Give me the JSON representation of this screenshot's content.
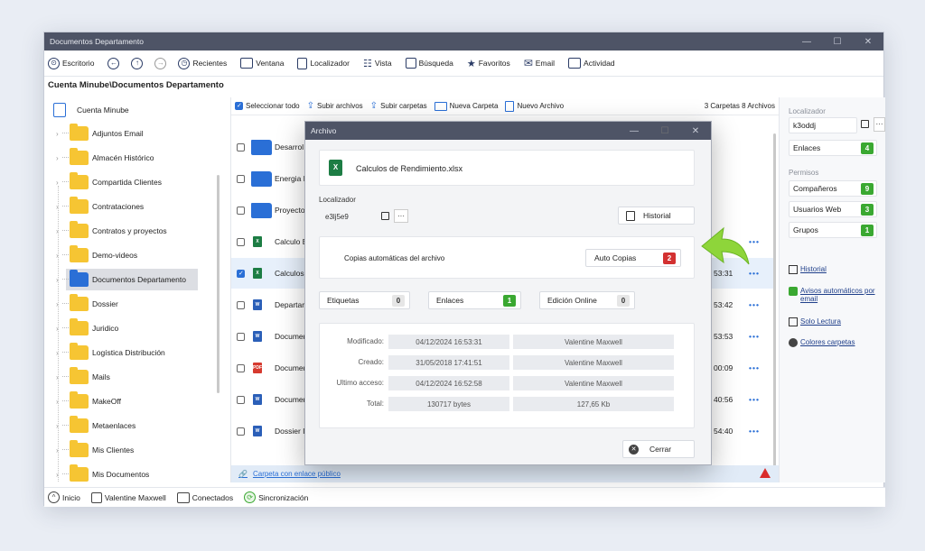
{
  "window": {
    "title": "Documentos Departamento"
  },
  "toolbar": {
    "items": [
      "Escritorio",
      "Recientes",
      "Ventana",
      "Localizador",
      "Vista",
      "Búsqueda",
      "Favoritos",
      "Email",
      "Actividad"
    ]
  },
  "path": "Cuenta Minube\\Documentos Departamento",
  "tree": {
    "root": "Cuenta Minube",
    "items": [
      "Adjuntos Email",
      "Almacén Histórico",
      "Compartida Clientes",
      "Contrataciones",
      "Contratos y proyectos",
      "Demo-videos",
      "Documentos Departamento",
      "Dossier",
      "Juridico",
      "Logística Distribución",
      "Mails",
      "MakeOff",
      "Metaenlaces",
      "Mis Clientes",
      "Mis Documentos"
    ],
    "selected_index": 6
  },
  "files": {
    "toolbar": [
      "Seleccionar todo",
      "Subir archivos",
      "Subir carpetas",
      "Nueva Carpeta",
      "Nuevo Archivo"
    ],
    "counts": "3 Carpetas  8 Archivos",
    "rows": [
      {
        "type": "folder",
        "name": "Desarrol",
        "time": ""
      },
      {
        "type": "folder",
        "name": "Energia I",
        "time": ""
      },
      {
        "type": "folder",
        "name": "Proyecto",
        "time": ""
      },
      {
        "type": "x",
        "name": "Calculo E",
        "time": ""
      },
      {
        "type": "x",
        "name": "Calculos",
        "time": "53:31",
        "selected": true
      },
      {
        "type": "w",
        "name": "Departar",
        "time": "53:42"
      },
      {
        "type": "w",
        "name": "Documer",
        "time": "53:53"
      },
      {
        "type": "p",
        "name": "Documer",
        "time": "00:09"
      },
      {
        "type": "w",
        "name": "Documer",
        "time": "40:56"
      },
      {
        "type": "w",
        "name": "Dossier I",
        "time": "54:40"
      }
    ],
    "footer_link": "Carpeta con enlace público"
  },
  "side": {
    "localizador_label": "Localizador",
    "localizador_value": "k3oddj",
    "enlaces_label": "Enlaces",
    "enlaces_count": "4",
    "permisos_label": "Permisos",
    "permisos": [
      {
        "label": "Compañeros",
        "count": "9"
      },
      {
        "label": "Usuarios Web",
        "count": "3"
      },
      {
        "label": "Grupos",
        "count": "1"
      }
    ],
    "links": [
      "Historial",
      "Avisos automáticos por email",
      "Solo Lectura",
      "Colores carpetas"
    ]
  },
  "status": {
    "items": [
      "Inicio",
      "Valentine Maxwell",
      "Conectados",
      "Sincronización"
    ]
  },
  "dialog": {
    "title": "Archivo",
    "filename": "Calculos de Rendimiento.xlsx",
    "localizador_label": "Localizador",
    "localizador_value": "e3lj5e9",
    "historial_btn": "Historial",
    "copias_label": "Copias automáticas del archivo",
    "auto_copias_btn": "Auto Copias",
    "auto_copias_count": "2",
    "etiquetas_label": "Etiquetas",
    "etiquetas_count": "0",
    "enlaces_label": "Enlaces",
    "enlaces_count": "1",
    "edicion_label": "Edición Online",
    "edicion_count": "0",
    "info": [
      {
        "label": "Modificado:",
        "value": "04/12/2024 16:53:31",
        "user": "Valentine Maxwell"
      },
      {
        "label": "Creado:",
        "value": "31/05/2018 17:41:51",
        "user": "Valentine Maxwell"
      },
      {
        "label": "Ultimo acceso:",
        "value": "04/12/2024 16:52:58",
        "user": "Valentine Maxwell"
      },
      {
        "label": "Total:",
        "value": "130717 bytes",
        "user": "127,65 Kb"
      }
    ],
    "cerrar_btn": "Cerrar"
  }
}
